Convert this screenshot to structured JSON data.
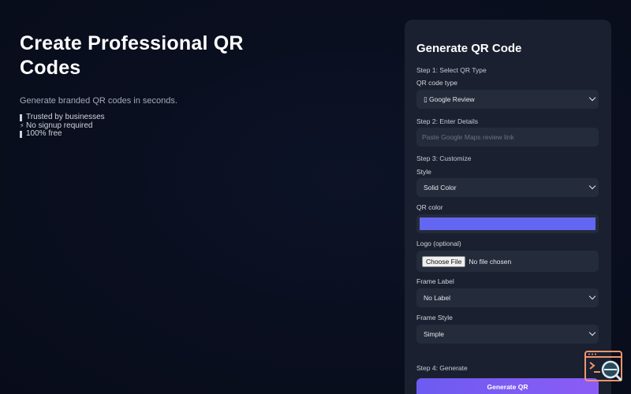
{
  "hero": {
    "title": "Create Professional QR Codes",
    "subtitle": "Generate branded QR codes in seconds.",
    "features": [
      {
        "icon": "bar-icon",
        "label": "Trusted by businesses"
      },
      {
        "icon": "lightning-icon",
        "label": "No signup required"
      },
      {
        "icon": "bar-icon",
        "label": "100% free"
      }
    ]
  },
  "panel": {
    "title": "Generate QR Code",
    "step1": "Step 1: Select QR Type",
    "qr_type_label": "QR code type",
    "qr_type_value": "▯ Google Review",
    "step2": "Step 2: Enter Details",
    "details_placeholder": "Paste Google Maps review link",
    "step3": "Step 3: Customize",
    "style_label": "Style",
    "style_value": "Solid Color",
    "qr_color_label": "QR color",
    "qr_color_value": "#6366f1",
    "logo_label": "Logo (optional)",
    "file_button": "Choose File",
    "file_status": "No file chosen",
    "frame_label_label": "Frame Label",
    "frame_label_value": "No Label",
    "frame_style_label": "Frame Style",
    "frame_style_value": "Simple",
    "step4": "Step 4: Generate",
    "generate_button": "Generate QR"
  },
  "colors": {
    "accent": "#6366f1",
    "panel_bg": "#1a2030",
    "control_bg": "#242b3a"
  }
}
